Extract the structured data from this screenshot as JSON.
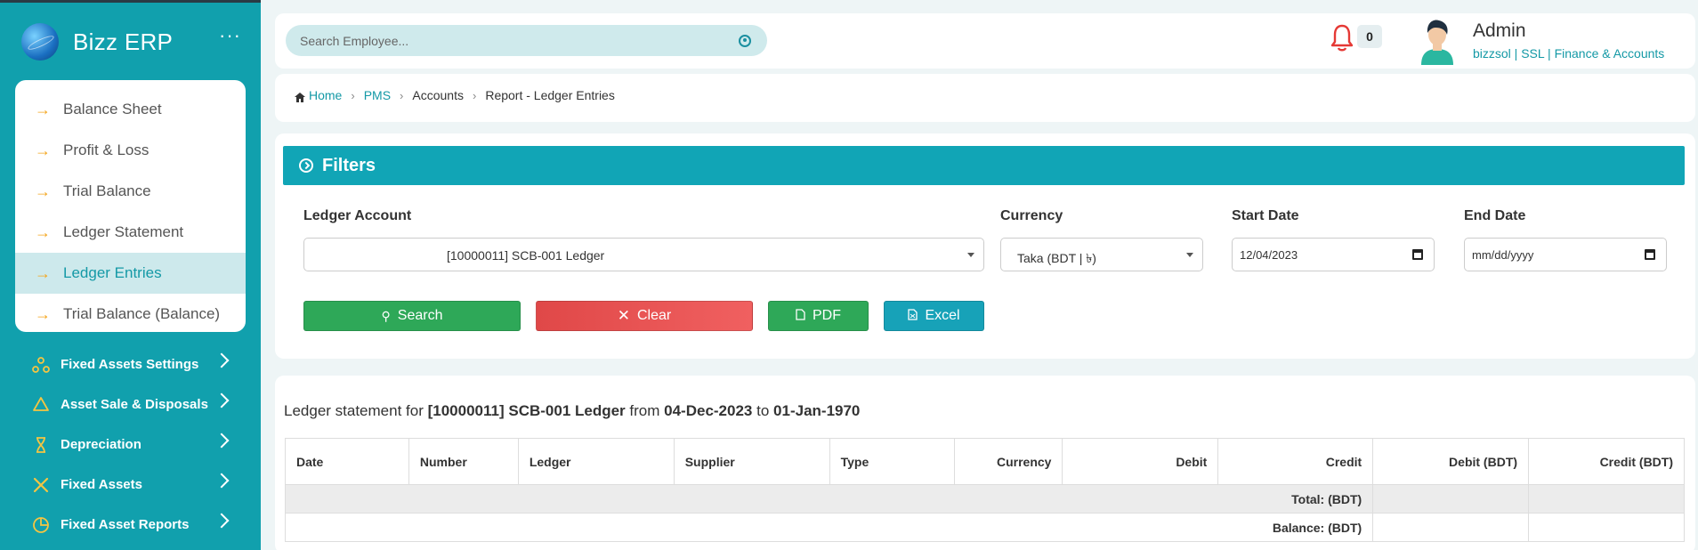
{
  "brand": {
    "name": "Bizz ERP",
    "menu_icon": "dots-icon"
  },
  "submenu": [
    {
      "label": "Balance Sheet",
      "active": false
    },
    {
      "label": "Profit & Loss",
      "active": false
    },
    {
      "label": "Trial Balance",
      "active": false
    },
    {
      "label": "Ledger Statement",
      "active": false
    },
    {
      "label": "Ledger Entries",
      "active": true
    },
    {
      "label": "Trial Balance (Balance)",
      "active": false
    }
  ],
  "nav": [
    {
      "label": "Fixed Assets Settings",
      "icon": "nodes-icon"
    },
    {
      "label": "Asset Sale & Disposals",
      "icon": "recycle-icon"
    },
    {
      "label": "Depreciation",
      "icon": "hourglass-icon"
    },
    {
      "label": "Fixed Assets",
      "icon": "tools-icon"
    },
    {
      "label": "Fixed Asset Reports",
      "icon": "pie-chart-icon"
    }
  ],
  "header": {
    "search_placeholder": "Search Employee...",
    "notification_count": "0",
    "user_name": "Admin",
    "user_meta": "bizzsol | SSL  | Finance & Accounts"
  },
  "breadcrumb": {
    "home": "Home",
    "pms": "PMS",
    "accounts": "Accounts",
    "current": "Report - Ledger Entries"
  },
  "filters": {
    "title": "Filters",
    "ledger_label": "Ledger Account",
    "ledger_value": "[10000011] SCB-001 Ledger",
    "currency_label": "Currency",
    "currency_value": "Taka (BDT | ৳)",
    "start_label": "Start Date",
    "start_value": "12/04/2023",
    "end_label": "End Date",
    "end_value": "mm/dd/yyyy",
    "search_btn": "Search",
    "clear_btn": "Clear",
    "pdf_btn": "PDF",
    "excel_btn": "Excel"
  },
  "report": {
    "prefix": "Ledger statement for",
    "ledger": "[10000011] SCB-001 Ledger",
    "from_word": "from",
    "from_date": "04-Dec-2023",
    "to_word": "to",
    "to_date": "01-Jan-1970",
    "columns": [
      "Date",
      "Number",
      "Ledger",
      "Supplier",
      "Type",
      "Currency",
      "Debit",
      "Credit",
      "Debit (BDT)",
      "Credit (BDT)"
    ],
    "total_label": "Total: (BDT)",
    "balance_label": "Balance: (BDT)"
  },
  "colors": {
    "sidebar": "#11a0ad",
    "accent": "#1499a6",
    "success": "#2ea858",
    "danger": "#e04848",
    "info": "#17a2b8"
  }
}
